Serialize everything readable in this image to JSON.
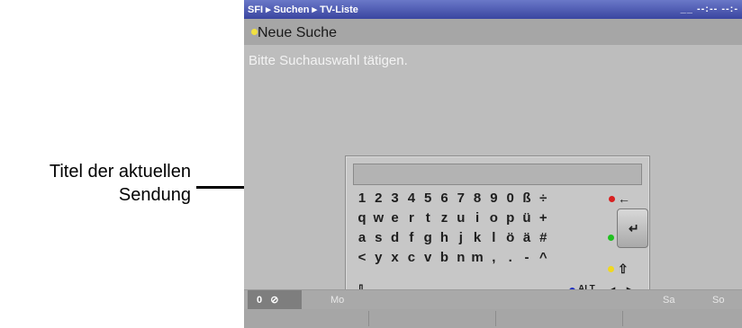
{
  "annotation": {
    "line1": "Titel der aktuellen",
    "line2": "Sendung"
  },
  "topbar": {
    "breadcrumb": "SFI ▸ Suchen ▸ TV-Liste",
    "clock": "__ --:-- --:-"
  },
  "header": {
    "title": "Neue Suche"
  },
  "hint": "Bitte Suchauswahl tätigen.",
  "keyboard": {
    "row1": [
      "1",
      "2",
      "3",
      "4",
      "5",
      "6",
      "7",
      "8",
      "9",
      "0",
      "ß",
      "÷"
    ],
    "row2": [
      "q",
      "w",
      "e",
      "r",
      "t",
      "z",
      "u",
      "i",
      "o",
      "p",
      "ü",
      "+"
    ],
    "row3": [
      "a",
      "s",
      "d",
      "f",
      "g",
      "h",
      "j",
      "k",
      "l",
      "ö",
      "ä",
      "#"
    ],
    "row4": [
      "<",
      "y",
      "x",
      "c",
      "v",
      "b",
      "n",
      "m",
      ",",
      ".",
      "-",
      "^"
    ],
    "backspace": "←",
    "enter": "↵",
    "shift": "⇧",
    "shift_lock": "⇩",
    "mode": "ALT",
    "left": "◂",
    "right": "▸",
    "colors": {
      "red": "#d82020",
      "green": "#20c020",
      "yellow": "#f0d820",
      "blue": "#2030c0"
    }
  },
  "daybar": {
    "first": "0",
    "mo": "Mo",
    "sa": "Sa",
    "so": "So"
  }
}
